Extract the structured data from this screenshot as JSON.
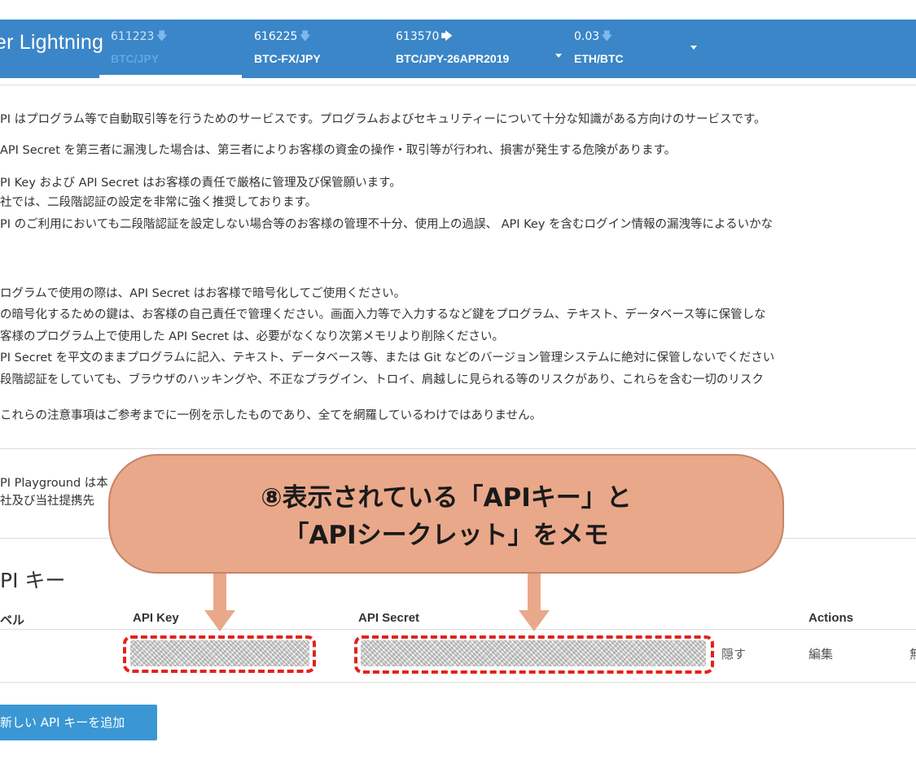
{
  "header": {
    "logo": "er Lightning",
    "tickers": [
      {
        "price": "611223",
        "pair": "BTC/JPY",
        "trend": "down"
      },
      {
        "price": "616225",
        "pair": "BTC-FX/JPY",
        "trend": "down"
      },
      {
        "price": "613570",
        "pair": "BTC/JPY-26APR2019",
        "trend": "right"
      },
      {
        "price": "0.03",
        "pair": "ETH/BTC",
        "trend": "down"
      }
    ]
  },
  "notice": {
    "lines": [
      "PI はプログラム等で自動取引等を行うためのサービスです。プログラムおよびセキュリティーについて十分な知識がある方向けのサービスです。",
      "API Secret を第三者に漏洩した場合は、第三者によりお客様の資金の操作・取引等が行われ、損害が発生する危険があります。",
      "PI Key および API Secret はお客様の責任で厳格に管理及び保管願います。",
      "社では、二段階認証の設定を非常に強く推奨しております。",
      "PI のご利用においても二段階認証を設定しない場合等のお客様の管理不十分、使用上の過誤、 API Key を含むログイン情報の漏洩等によるいかな",
      "ログラムで使用の際は、API Secret はお客様で暗号化してご使用ください。",
      "の暗号化するための鍵は、お客様の自己責任で管理ください。画面入力等で入力するなど鍵をプログラム、テキスト、データベース等に保管しな",
      "客様のプログラム上で使用した API Secret は、必要がなくなり次第メモリより削除ください。",
      "PI Secret を平文のままプログラムに記入、テキスト、データベース等、または Git などのバージョン管理システムに絶対に保管しないでください",
      "段階認証をしていても、ブラウザのハッキングや、不正なプラグイン、トロイ、肩越しに見られる等のリスクがあり、これらを含む一切のリスク",
      "これらの注意事項はご参考までに一例を示したものであり、全てを網羅しているわけではありません。"
    ],
    "playground_lines": [
      "PI Playground は本",
      "社及び当社提携先"
    ]
  },
  "api_keys": {
    "title": "PI キー",
    "columns": {
      "level": "ベル",
      "key": "API Key",
      "secret": "API Secret",
      "actions": "Actions"
    },
    "row": {
      "hide": "隠す",
      "edit": "編集",
      "delete": "無"
    },
    "add_button": "新しい API キーを追加"
  },
  "annotation": {
    "line1": "⑧表示されている「APIキー」と",
    "line2": "「APIシークレット」をメモ",
    "color": "#e9a88a",
    "highlight_color": "#e2231a"
  }
}
